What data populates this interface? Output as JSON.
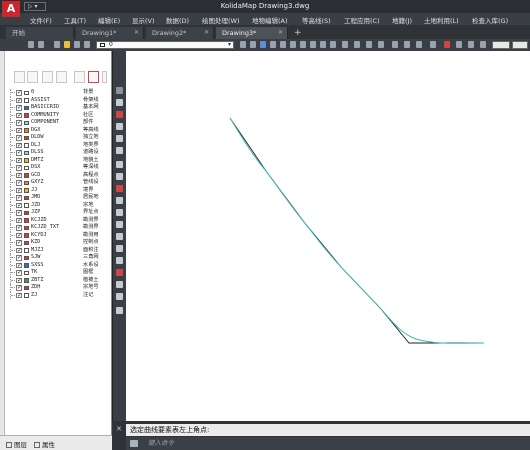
{
  "app": {
    "logo": "A",
    "quick_access": "▷ ▾",
    "title": "KolidaMap   Drawing3.dwg"
  },
  "menu": [
    "文件(F)",
    "工具(T)",
    "编辑(E)",
    "显示(V)",
    "数据(D)",
    "绘图处理(W)",
    "地物编辑(A)",
    "等高线(S)",
    "工程应用(C)",
    "地籍(J)",
    "土地利用(L)",
    "检查入库(G)"
  ],
  "tabs": [
    {
      "label": "开始",
      "active": false
    },
    {
      "label": "Drawing1*",
      "active": false
    },
    {
      "label": "Drawing2*",
      "active": false
    },
    {
      "label": "Drawing3*",
      "active": true
    }
  ],
  "tab_add": "+",
  "layer_combo": {
    "value": "0"
  },
  "layers": [
    {
      "name": "0",
      "desc": "背景",
      "color": "#ffffff"
    },
    {
      "name": "ASSIST",
      "desc": "骨架线",
      "color": "#ffffff"
    },
    {
      "name": "BASICCRID",
      "desc": "基本网",
      "color": "#2e6fd6"
    },
    {
      "name": "COMMUNITY",
      "desc": "社区",
      "color": "#d93b3b"
    },
    {
      "name": "COMPONENT",
      "desc": "部件",
      "color": "#7fe0e0"
    },
    {
      "name": "DGX",
      "desc": "等高线",
      "color": "#e08a2e"
    },
    {
      "name": "DLDW",
      "desc": "独立地",
      "color": "#d93b3b"
    },
    {
      "name": "DLJ",
      "desc": "地类界",
      "color": "#ffffff"
    },
    {
      "name": "DLSS",
      "desc": "道路设",
      "color": "#7fe0e0"
    },
    {
      "name": "DMTZ",
      "desc": "地貌土",
      "color": "#e0c020"
    },
    {
      "name": "DSX",
      "desc": "等深线",
      "color": "#ffffff"
    },
    {
      "name": "GCD",
      "desc": "高程点",
      "color": "#d93b3b"
    },
    {
      "name": "GXYZ",
      "desc": "管线设",
      "color": "#e08a2e"
    },
    {
      "name": "JJ",
      "desc": "境界",
      "color": "#e0c020"
    },
    {
      "name": "JMD",
      "desc": "居民地",
      "color": "#d93b3b"
    },
    {
      "name": "JZD",
      "desc": "宗地",
      "color": "#ffffff"
    },
    {
      "name": "JZP",
      "desc": "界址点",
      "color": "#d93b3b"
    },
    {
      "name": "KCJZD",
      "desc": "勘测界",
      "color": "#d93b3b"
    },
    {
      "name": "KCJZD_TXT",
      "desc": "勘测界",
      "color": "#d93b3b"
    },
    {
      "name": "KCYDJ",
      "desc": "勘测用",
      "color": "#d93b3b"
    },
    {
      "name": "KZD",
      "desc": "控制点",
      "color": "#d93b3b"
    },
    {
      "name": "MJZJ",
      "desc": "面积注",
      "color": "#ffffff"
    },
    {
      "name": "SJW",
      "desc": "三角网",
      "color": "#d93b3b"
    },
    {
      "name": "SXSS",
      "desc": "水系设",
      "color": "#2e6fd6"
    },
    {
      "name": "TK",
      "desc": "图框",
      "color": "#ffffff"
    },
    {
      "name": "ZBTZ",
      "desc": "植被土",
      "color": "#3aa54a"
    },
    {
      "name": "ZDH",
      "desc": "宗地号",
      "color": "#d93b3b"
    },
    {
      "name": "ZJ",
      "desc": "注记",
      "color": "#ffffff"
    }
  ],
  "command": {
    "history": "选定曲线要素表左上角点:",
    "placeholder": "键入命令"
  },
  "palette_tabs": [
    "图层",
    "属性"
  ],
  "colors": {
    "curve": "#40b8b8",
    "polyline": "#222222",
    "titlebar": "#2b2f35"
  }
}
